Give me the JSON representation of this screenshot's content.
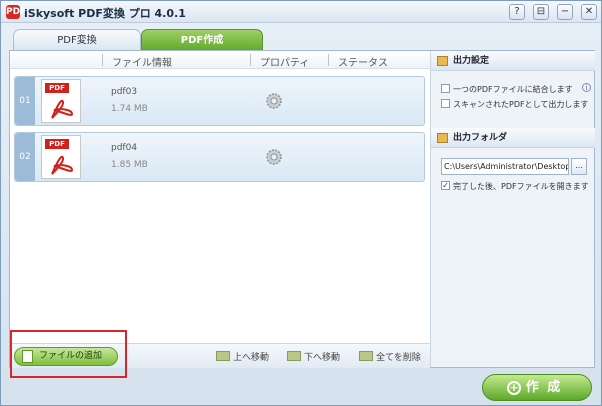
{
  "app": {
    "logo": "PDF",
    "title": "iSkysoft PDF変換 プロ 4.0.1"
  },
  "window_controls": {
    "help": "?",
    "settings": "⊟",
    "minimize": "−",
    "close": "✕"
  },
  "tabs": [
    {
      "label": "PDF変換",
      "active": false
    },
    {
      "label": "PDF作成",
      "active": true
    }
  ],
  "columns": {
    "file_info": "ファイル情報",
    "properties": "プロパティ",
    "status": "ステータス"
  },
  "files": [
    {
      "number": "01",
      "name": "pdf03",
      "size": "1.74 MB",
      "icon_tag": "PDF"
    },
    {
      "number": "02",
      "name": "pdf04",
      "size": "1.85 MB",
      "icon_tag": "PDF"
    }
  ],
  "toolbar": {
    "add_label": "ファイルの追加",
    "move_up_label": "上へ移動",
    "move_down_label": "下へ移動",
    "delete_all_label": "全てを削除"
  },
  "output_settings": {
    "title": "出力設定",
    "merge_label": "一つのPDFファイルに結合します",
    "merge_checked": false,
    "scan_label": "スキャンされたPDFとして出力します",
    "scan_checked": false,
    "info": "i"
  },
  "output_folder": {
    "title": "出力フォルダ",
    "path": "C:\\Users\\Administrator\\Desktop\\",
    "browse_label": "...",
    "open_after_label": "完了した後、PDFファイルを開きます",
    "open_after_checked": true,
    "check_mark": "✓"
  },
  "create_button": {
    "label": "作 成",
    "icon": "+"
  },
  "colors": {
    "accent_green": "#7fbf3d",
    "highlight_red": "#d9262c",
    "row_blue": "#d9e8f5"
  }
}
